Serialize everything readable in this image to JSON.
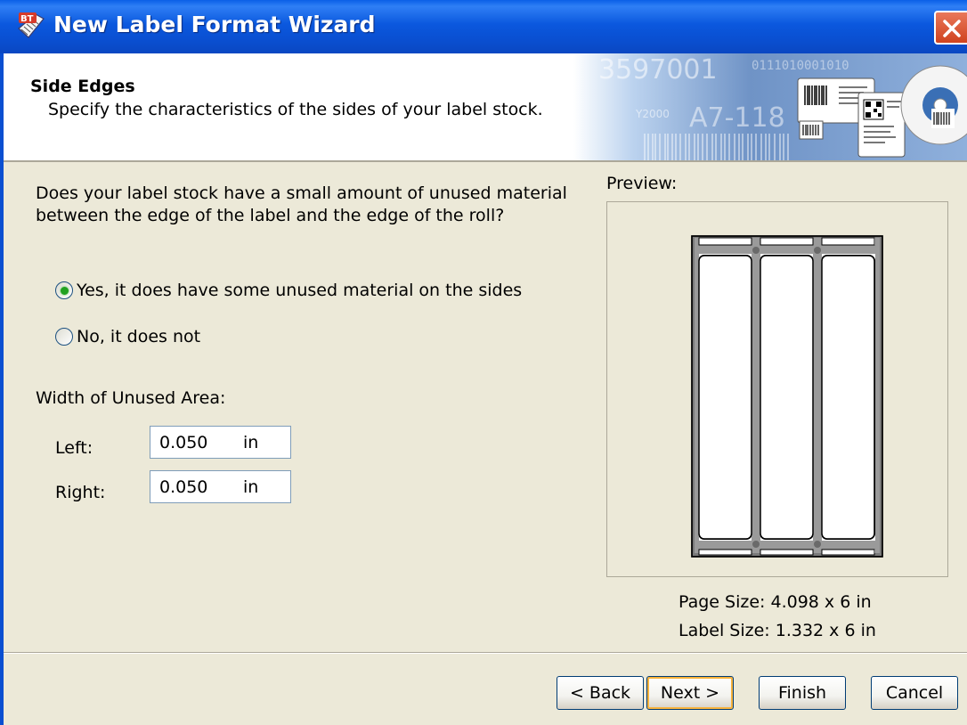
{
  "window": {
    "title": "New Label Format Wizard",
    "app_icon": "bartender-icon",
    "close_icon": "close-icon"
  },
  "header": {
    "title": "Side Edges",
    "subtitle": "Specify the characteristics of the sides of your label stock.",
    "banner_text": [
      "3597001",
      "A7-118",
      "Y2000",
      "0111010001010"
    ]
  },
  "question": "Does your label stock have a small amount of unused material between the edge of the label and the edge of the roll?",
  "options": [
    {
      "label": "Yes, it does have some unused material on the sides",
      "selected": true
    },
    {
      "label": "No, it does not",
      "selected": false
    }
  ],
  "unused_area": {
    "heading": "Width of Unused Area:",
    "left_label": "Left:",
    "left_value": "0.050",
    "right_label": "Right:",
    "right_value": "0.050",
    "unit": "in"
  },
  "preview": {
    "label": "Preview:",
    "page_size": "Page Size:  4.098 x 6 in",
    "label_size": "Label Size:  1.332 x 6 in"
  },
  "buttons": {
    "back": "< Back",
    "next": "Next >",
    "finish": "Finish",
    "cancel": "Cancel"
  },
  "colors": {
    "titlebar": "#0a4fd1",
    "dialog_bg": "#ece9d8",
    "radio_selected": "#21a121",
    "default_button_focus": "#f8b33c"
  }
}
